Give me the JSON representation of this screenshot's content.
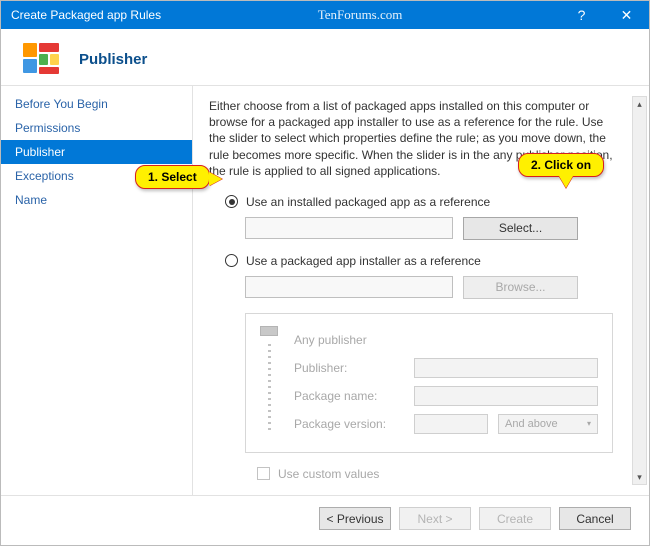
{
  "titlebar": {
    "title": "Create Packaged app Rules",
    "watermark": "TenForums.com"
  },
  "header": {
    "title": "Publisher"
  },
  "sidebar": {
    "items": [
      {
        "label": "Before You Begin",
        "selected": false
      },
      {
        "label": "Permissions",
        "selected": false
      },
      {
        "label": "Publisher",
        "selected": true
      },
      {
        "label": "Exceptions",
        "selected": false
      },
      {
        "label": "Name",
        "selected": false
      }
    ]
  },
  "main": {
    "description": "Either choose from a list of packaged apps installed on this computer or browse for a packaged app installer to use as a reference for the rule. Use the slider to select which properties define the rule; as you move down, the rule becomes more specific. When the slider is in the any publisher position, the rule is applied to all signed applications.",
    "radio_installed_label": "Use an installed packaged app as a reference",
    "radio_installer_label": "Use a packaged app installer as a reference",
    "select_button": "Select...",
    "browse_button": "Browse...",
    "slider": {
      "row1": "Any publisher",
      "row2": "Publisher:",
      "row3": "Package name:",
      "row4": "Package version:",
      "dropdown": "And above"
    },
    "custom_values_label": "Use custom values"
  },
  "footer": {
    "prev": "< Previous",
    "next": "Next >",
    "create": "Create",
    "cancel": "Cancel"
  },
  "annotations": {
    "a1": "1. Select",
    "a2": "2. Click on"
  }
}
